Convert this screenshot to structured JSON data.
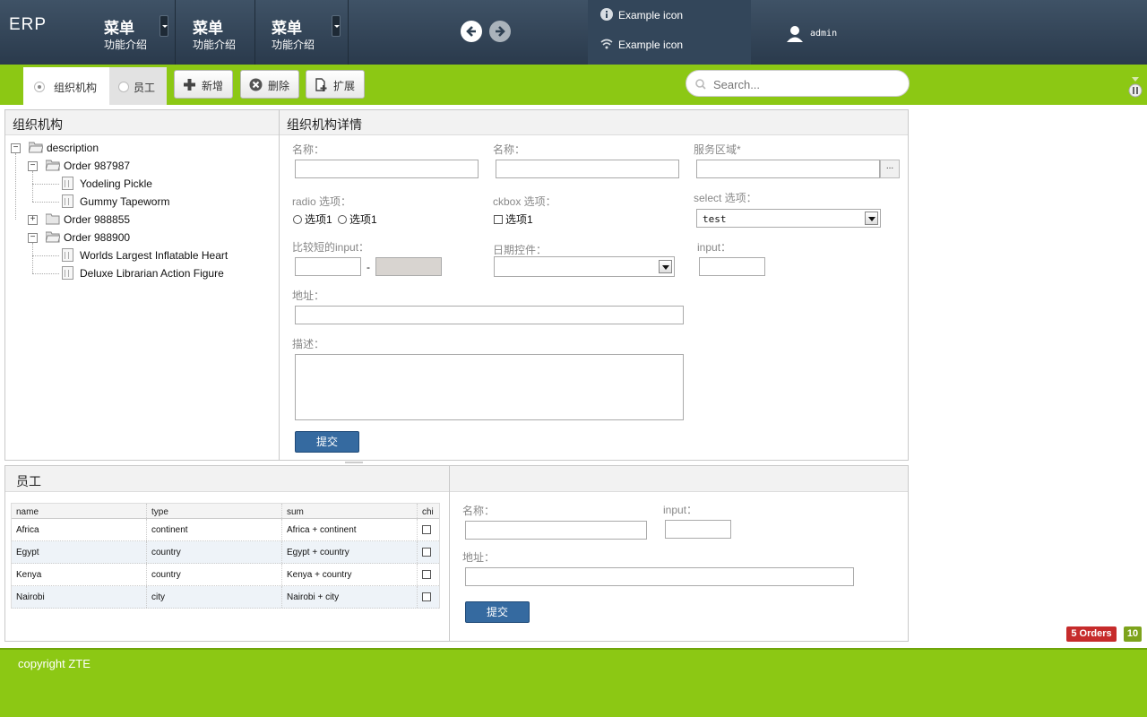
{
  "header": {
    "logo": "ERP",
    "menus": [
      {
        "title": "菜单",
        "subtitle": "功能介绍"
      },
      {
        "title": "菜单",
        "subtitle": "功能介绍"
      },
      {
        "title": "菜单",
        "subtitle": "功能介绍"
      }
    ],
    "examples": [
      {
        "icon": "info-icon",
        "label": "Example icon"
      },
      {
        "icon": "wifi-icon",
        "label": "Example icon"
      }
    ],
    "user": "admin"
  },
  "toolbar": {
    "tabs": [
      {
        "label": "组织机构",
        "selected": true
      },
      {
        "label": "员工",
        "selected": false
      }
    ],
    "buttons": [
      {
        "icon": "plus-icon",
        "label": "新增"
      },
      {
        "icon": "delete-icon",
        "label": "删除"
      },
      {
        "icon": "extend-icon",
        "label": "扩展"
      }
    ],
    "search_placeholder": "Search..."
  },
  "org_panel": {
    "title": "组织机构",
    "tree": {
      "root": "description",
      "nodes": [
        {
          "label": "Order 987987",
          "expanded": true,
          "children": [
            "Yodeling Pickle",
            "Gummy Tapeworm"
          ]
        },
        {
          "label": "Order 988855",
          "expanded": false,
          "children": []
        },
        {
          "label": "Order 988900",
          "expanded": true,
          "children": [
            "Worlds Largest Inflatable Heart",
            "Deluxe Librarian Action Figure"
          ]
        }
      ]
    }
  },
  "detail_panel": {
    "title": "组织机构详情",
    "name1_label": "名称：",
    "name2_label": "名称：",
    "service_area_label": "服务区域*",
    "service_area_button": "...",
    "radio_label": "radio 选项：",
    "radio_options": [
      "选项1",
      "选项1"
    ],
    "ckbox_label": "ckbox 选项：",
    "ckbox_option": "选项1",
    "select_label": "select 选项：",
    "select_value": "test",
    "short_input_label": "比较短的input：",
    "range_separator": "-",
    "date_label": "日期控件：",
    "input_label": "input：",
    "address_label": "地址：",
    "description_label": "描述：",
    "submit_label": "提交"
  },
  "employee_panel": {
    "title": "员工",
    "columns": [
      "name",
      "type",
      "sum",
      "chi"
    ],
    "rows": [
      {
        "name": "Africa",
        "type": "continent",
        "sum": "Africa + continent"
      },
      {
        "name": "Egypt",
        "type": "country",
        "sum": "Egypt + country"
      },
      {
        "name": "Kenya",
        "type": "country",
        "sum": "Kenya + country"
      },
      {
        "name": "Nairobi",
        "type": "city",
        "sum": "Nairobi + city"
      }
    ]
  },
  "employee_form": {
    "name_label": "名称：",
    "input_label": "input：",
    "address_label": "地址：",
    "submit_label": "提交"
  },
  "badges": {
    "orders": "5 Orders",
    "count": "10"
  },
  "footer": {
    "copyright": "copyright ZTE"
  },
  "colors": {
    "accent_green": "#8cc814",
    "header_dark": "#2f4153",
    "submit_blue": "#356aa0",
    "badge_red": "#c62b2b"
  }
}
